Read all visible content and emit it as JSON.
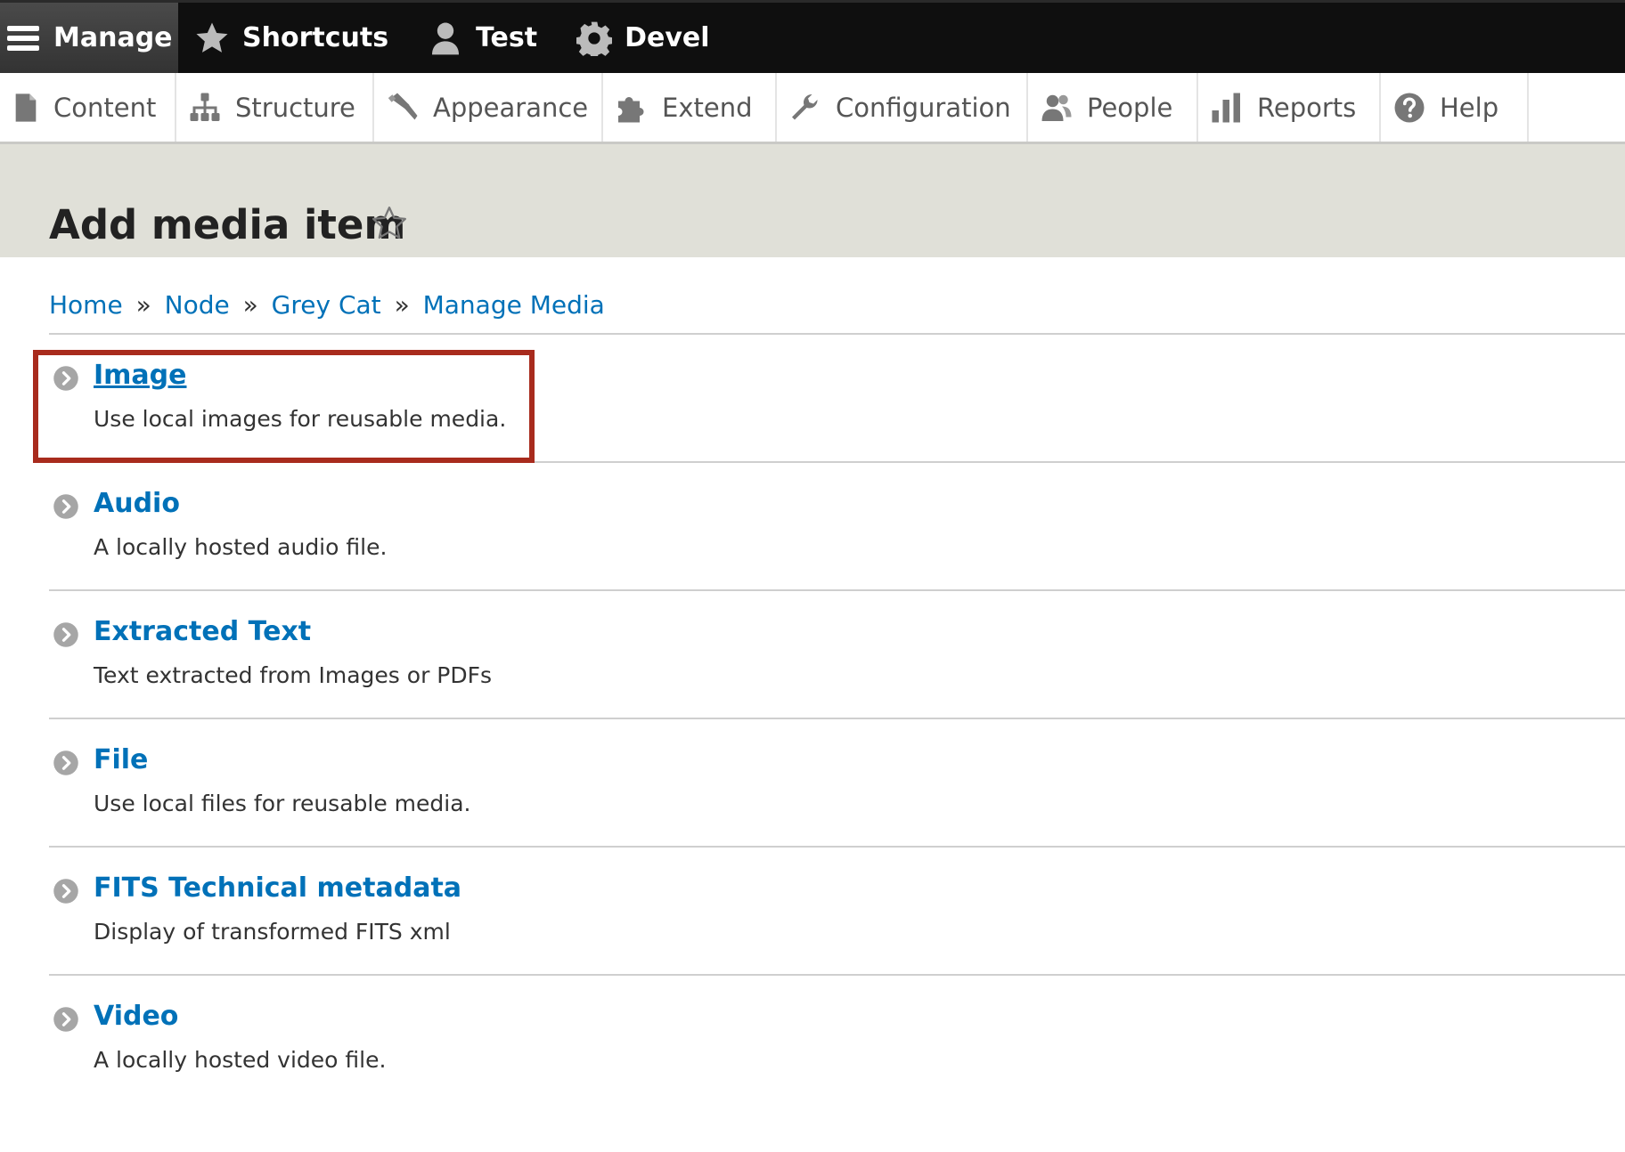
{
  "toolbar": {
    "manage": "Manage",
    "shortcuts": "Shortcuts",
    "user": "Test",
    "devel": "Devel"
  },
  "tray": {
    "items": [
      {
        "label": "Content",
        "icon": "page-icon"
      },
      {
        "label": "Structure",
        "icon": "sitemap-icon"
      },
      {
        "label": "Appearance",
        "icon": "paintbrush-icon"
      },
      {
        "label": "Extend",
        "icon": "puzzle-icon"
      },
      {
        "label": "Configuration",
        "icon": "wrench-icon"
      },
      {
        "label": "People",
        "icon": "people-icon"
      },
      {
        "label": "Reports",
        "icon": "bar-chart-icon"
      },
      {
        "label": "Help",
        "icon": "help-icon"
      }
    ]
  },
  "page": {
    "title": "Add media item"
  },
  "breadcrumb": [
    "Home",
    "Node",
    "Grey Cat",
    "Manage Media"
  ],
  "breadcrumb_separator": "»",
  "media_types": [
    {
      "label": "Image",
      "description": "Use local images for reusable media."
    },
    {
      "label": "Audio",
      "description": "A locally hosted audio file."
    },
    {
      "label": "Extracted Text",
      "description": "Text extracted from Images or PDFs"
    },
    {
      "label": "File",
      "description": "Use local files for reusable media."
    },
    {
      "label": "FITS Technical metadata",
      "description": "Display of transformed FITS xml"
    },
    {
      "label": "Video",
      "description": "A locally hosted video file."
    }
  ],
  "colors": {
    "link": "#0071b8",
    "toolbar_bg": "#0f0f0f",
    "header_bg": "#e0e0d8",
    "highlight": "#a82b1d"
  }
}
